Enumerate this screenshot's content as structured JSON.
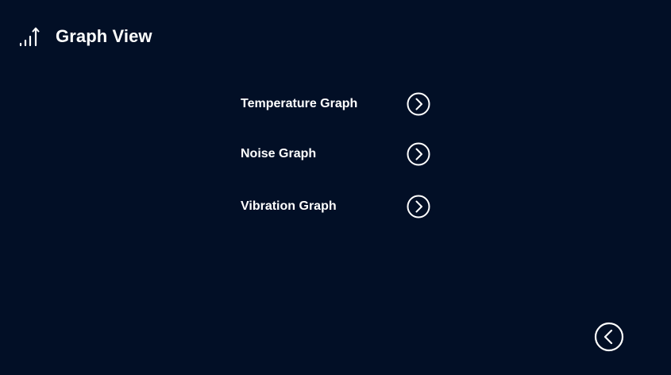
{
  "header": {
    "title": "Graph View",
    "icon": "signal-bars-arrow-icon"
  },
  "menu": {
    "items": [
      {
        "label": "Temperature Graph",
        "icon": "chevron-right-circle-icon"
      },
      {
        "label": "Noise Graph",
        "icon": "chevron-right-circle-icon"
      },
      {
        "label": "Vibration Graph",
        "icon": "chevron-right-circle-icon"
      }
    ]
  },
  "footer": {
    "back_icon": "chevron-left-circle-icon"
  },
  "colors": {
    "background": "#020f26",
    "foreground": "#ffffff"
  }
}
